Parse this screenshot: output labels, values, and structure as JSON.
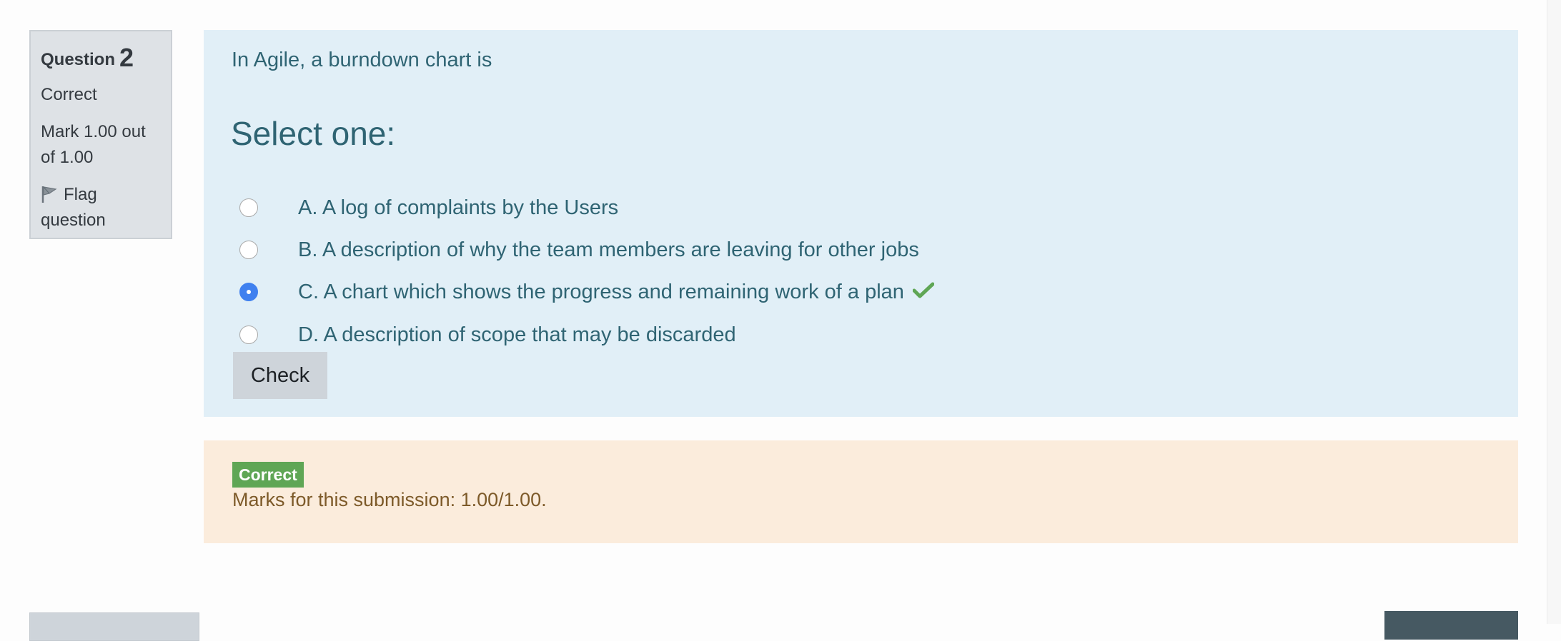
{
  "question_info": {
    "label": "Question",
    "number": "2",
    "state": "Correct",
    "grade": "Mark 1.00 out of 1.00",
    "flag_label": "Flag question",
    "flag_icon": "flag-icon"
  },
  "formulation": {
    "question_text": "In Agile, a burndown chart is",
    "prompt": "Select one:",
    "options": [
      {
        "letter": "A.",
        "text": "A log of complaints by the Users",
        "selected": false
      },
      {
        "letter": "B.",
        "text": "A description of why the team members are leaving for other jobs",
        "selected": false
      },
      {
        "letter": "C.",
        "text": "A chart which shows the progress and remaining work of  a plan",
        "selected": true,
        "correct_icon": "checkmark-icon"
      },
      {
        "letter": "D.",
        "text": "A description of scope that may be discarded",
        "selected": false
      }
    ],
    "check_button": "Check"
  },
  "outcome": {
    "badge": "Correct",
    "marks_text": "Marks for this submission: 1.00/1.00."
  },
  "colors": {
    "info_bg": "#dee2e6",
    "formulation_bg": "#e1eff7",
    "formulation_text": "#2f6473",
    "outcome_bg": "#fbecdc",
    "outcome_text": "#7d5a29",
    "correct_green": "#5fa655",
    "radio_selected": "#3f80ef"
  }
}
